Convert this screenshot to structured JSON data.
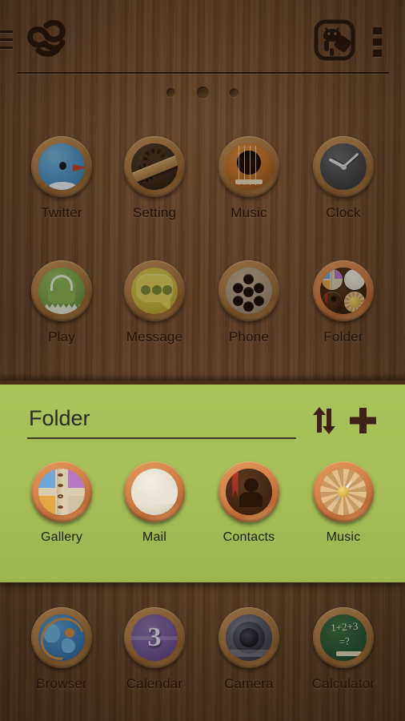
{
  "statusbar": {
    "present": false
  },
  "topbar": {
    "menu_icon": "hamburger-icon",
    "logo_icon": "launcher-logo-icon",
    "app_drawer_icon": "android-robot-icon",
    "overflow_icon": "overflow-menu-icon"
  },
  "page_indicator": {
    "count": 3,
    "active_index": 1
  },
  "home": {
    "rows": [
      {
        "apps": [
          {
            "label": "Twitter",
            "icon": "twitter-bird-icon"
          },
          {
            "label": "Setting",
            "icon": "gears-settings-icon"
          },
          {
            "label": "Music",
            "icon": "guitar-music-icon"
          },
          {
            "label": "Clock",
            "icon": "analog-clock-icon"
          }
        ]
      },
      {
        "apps": [
          {
            "label": "Play",
            "icon": "play-store-bag-icon"
          },
          {
            "label": "Message",
            "icon": "speech-bubble-message-icon"
          },
          {
            "label": "Phone",
            "icon": "phone-dialpad-icon"
          },
          {
            "label": "Folder",
            "icon": "folder-icon"
          }
        ]
      },
      {
        "apps": [
          {
            "label": "Browser",
            "icon": "globe-browser-icon"
          },
          {
            "label": "Calendar",
            "icon": "calendar-icon",
            "day": "3"
          },
          {
            "label": "Camera",
            "icon": "camera-lens-icon"
          },
          {
            "label": "Calculator",
            "icon": "chalkboard-calculator-icon",
            "expression_line1": "1+2+3",
            "expression_line2": "=?"
          }
        ]
      }
    ]
  },
  "folder_panel": {
    "title_value": "Folder",
    "title_placeholder": "Folder",
    "sort_icon": "sort-arrows-icon",
    "add_icon": "plus-icon",
    "apps": [
      {
        "label": "Gallery",
        "icon": "photo-album-gallery-icon"
      },
      {
        "label": "Mail",
        "icon": "envelope-mail-icon"
      },
      {
        "label": "Contacts",
        "icon": "contacts-book-icon"
      },
      {
        "label": "Music",
        "icon": "compass-music-icon"
      }
    ]
  },
  "colors": {
    "wood": "#7a5231",
    "folder_green": "#a4bd58",
    "label_brown": "#2f1c0e",
    "icon_dark": "#2e1a0e",
    "folder_border": "#4a2d16"
  }
}
